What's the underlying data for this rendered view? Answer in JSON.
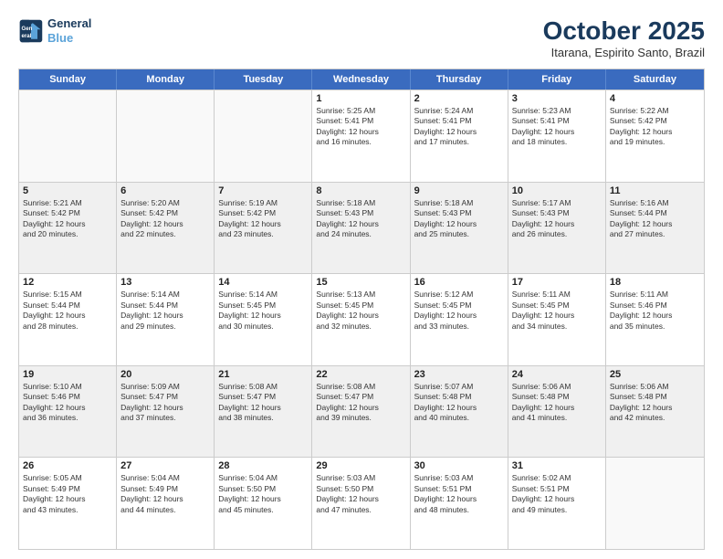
{
  "header": {
    "logo_line1": "General",
    "logo_line2": "Blue",
    "month": "October 2025",
    "location": "Itarana, Espirito Santo, Brazil"
  },
  "weekdays": [
    "Sunday",
    "Monday",
    "Tuesday",
    "Wednesday",
    "Thursday",
    "Friday",
    "Saturday"
  ],
  "weeks": [
    [
      {
        "day": "",
        "detail": ""
      },
      {
        "day": "",
        "detail": ""
      },
      {
        "day": "",
        "detail": ""
      },
      {
        "day": "1",
        "detail": "Sunrise: 5:25 AM\nSunset: 5:41 PM\nDaylight: 12 hours\nand 16 minutes."
      },
      {
        "day": "2",
        "detail": "Sunrise: 5:24 AM\nSunset: 5:41 PM\nDaylight: 12 hours\nand 17 minutes."
      },
      {
        "day": "3",
        "detail": "Sunrise: 5:23 AM\nSunset: 5:41 PM\nDaylight: 12 hours\nand 18 minutes."
      },
      {
        "day": "4",
        "detail": "Sunrise: 5:22 AM\nSunset: 5:42 PM\nDaylight: 12 hours\nand 19 minutes."
      }
    ],
    [
      {
        "day": "5",
        "detail": "Sunrise: 5:21 AM\nSunset: 5:42 PM\nDaylight: 12 hours\nand 20 minutes."
      },
      {
        "day": "6",
        "detail": "Sunrise: 5:20 AM\nSunset: 5:42 PM\nDaylight: 12 hours\nand 22 minutes."
      },
      {
        "day": "7",
        "detail": "Sunrise: 5:19 AM\nSunset: 5:42 PM\nDaylight: 12 hours\nand 23 minutes."
      },
      {
        "day": "8",
        "detail": "Sunrise: 5:18 AM\nSunset: 5:43 PM\nDaylight: 12 hours\nand 24 minutes."
      },
      {
        "day": "9",
        "detail": "Sunrise: 5:18 AM\nSunset: 5:43 PM\nDaylight: 12 hours\nand 25 minutes."
      },
      {
        "day": "10",
        "detail": "Sunrise: 5:17 AM\nSunset: 5:43 PM\nDaylight: 12 hours\nand 26 minutes."
      },
      {
        "day": "11",
        "detail": "Sunrise: 5:16 AM\nSunset: 5:44 PM\nDaylight: 12 hours\nand 27 minutes."
      }
    ],
    [
      {
        "day": "12",
        "detail": "Sunrise: 5:15 AM\nSunset: 5:44 PM\nDaylight: 12 hours\nand 28 minutes."
      },
      {
        "day": "13",
        "detail": "Sunrise: 5:14 AM\nSunset: 5:44 PM\nDaylight: 12 hours\nand 29 minutes."
      },
      {
        "day": "14",
        "detail": "Sunrise: 5:14 AM\nSunset: 5:45 PM\nDaylight: 12 hours\nand 30 minutes."
      },
      {
        "day": "15",
        "detail": "Sunrise: 5:13 AM\nSunset: 5:45 PM\nDaylight: 12 hours\nand 32 minutes."
      },
      {
        "day": "16",
        "detail": "Sunrise: 5:12 AM\nSunset: 5:45 PM\nDaylight: 12 hours\nand 33 minutes."
      },
      {
        "day": "17",
        "detail": "Sunrise: 5:11 AM\nSunset: 5:45 PM\nDaylight: 12 hours\nand 34 minutes."
      },
      {
        "day": "18",
        "detail": "Sunrise: 5:11 AM\nSunset: 5:46 PM\nDaylight: 12 hours\nand 35 minutes."
      }
    ],
    [
      {
        "day": "19",
        "detail": "Sunrise: 5:10 AM\nSunset: 5:46 PM\nDaylight: 12 hours\nand 36 minutes."
      },
      {
        "day": "20",
        "detail": "Sunrise: 5:09 AM\nSunset: 5:47 PM\nDaylight: 12 hours\nand 37 minutes."
      },
      {
        "day": "21",
        "detail": "Sunrise: 5:08 AM\nSunset: 5:47 PM\nDaylight: 12 hours\nand 38 minutes."
      },
      {
        "day": "22",
        "detail": "Sunrise: 5:08 AM\nSunset: 5:47 PM\nDaylight: 12 hours\nand 39 minutes."
      },
      {
        "day": "23",
        "detail": "Sunrise: 5:07 AM\nSunset: 5:48 PM\nDaylight: 12 hours\nand 40 minutes."
      },
      {
        "day": "24",
        "detail": "Sunrise: 5:06 AM\nSunset: 5:48 PM\nDaylight: 12 hours\nand 41 minutes."
      },
      {
        "day": "25",
        "detail": "Sunrise: 5:06 AM\nSunset: 5:48 PM\nDaylight: 12 hours\nand 42 minutes."
      }
    ],
    [
      {
        "day": "26",
        "detail": "Sunrise: 5:05 AM\nSunset: 5:49 PM\nDaylight: 12 hours\nand 43 minutes."
      },
      {
        "day": "27",
        "detail": "Sunrise: 5:04 AM\nSunset: 5:49 PM\nDaylight: 12 hours\nand 44 minutes."
      },
      {
        "day": "28",
        "detail": "Sunrise: 5:04 AM\nSunset: 5:50 PM\nDaylight: 12 hours\nand 45 minutes."
      },
      {
        "day": "29",
        "detail": "Sunrise: 5:03 AM\nSunset: 5:50 PM\nDaylight: 12 hours\nand 47 minutes."
      },
      {
        "day": "30",
        "detail": "Sunrise: 5:03 AM\nSunset: 5:51 PM\nDaylight: 12 hours\nand 48 minutes."
      },
      {
        "day": "31",
        "detail": "Sunrise: 5:02 AM\nSunset: 5:51 PM\nDaylight: 12 hours\nand 49 minutes."
      },
      {
        "day": "",
        "detail": ""
      }
    ]
  ]
}
